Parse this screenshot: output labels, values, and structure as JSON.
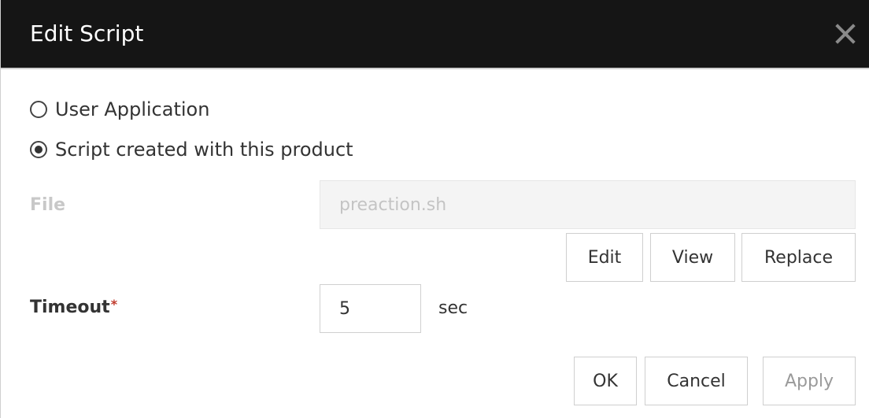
{
  "dialog": {
    "title": "Edit Script",
    "close_icon": "close-icon"
  },
  "source": {
    "options": [
      {
        "label": "User Application",
        "checked": false
      },
      {
        "label": "Script created with this product",
        "checked": true
      }
    ]
  },
  "file": {
    "label": "File",
    "value": "preaction.sh",
    "enabled": false,
    "buttons": {
      "edit": "Edit",
      "view": "View",
      "replace": "Replace"
    }
  },
  "timeout": {
    "label": "Timeout",
    "required_mark": "*",
    "value": "5",
    "unit": "sec"
  },
  "footer": {
    "ok": "OK",
    "cancel": "Cancel",
    "apply": "Apply",
    "apply_enabled": false
  },
  "colors": {
    "titlebar": "#151515",
    "required": "#c0392b"
  }
}
